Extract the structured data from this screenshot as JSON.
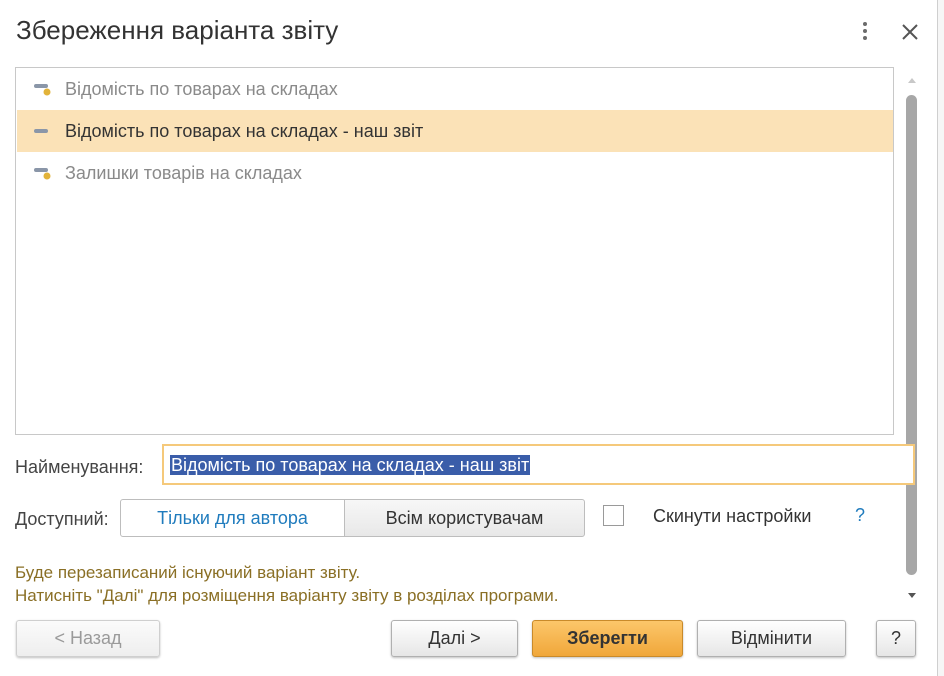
{
  "dialog": {
    "title": "Збереження варіанта звіту"
  },
  "list": {
    "items": [
      {
        "label": "Відомість по товарах на складах"
      },
      {
        "label": "Відомість по товарах на складах - наш звіт"
      },
      {
        "label": "Залишки товарів на складах"
      }
    ]
  },
  "form": {
    "name_label": "Найменування:",
    "name_value": "Відомість по товарах на складах - наш звіт",
    "available_label": "Доступний:",
    "option_author": "Тільки для автора",
    "option_all": "Всім користувачам",
    "reset_label": "Скинути настройки",
    "help": "?"
  },
  "info": {
    "line1": "Буде перезаписаний існуючий варіант звіту.",
    "line2": "Натисніть \"Далі\" для розміщення варіанту звіту в розділах програми."
  },
  "buttons": {
    "back": "<  Назад",
    "next": "Далі  >",
    "save": "Зберегти",
    "cancel": "Відмінити",
    "help": "?"
  },
  "colors": {
    "selected_row": "#fbe2b7",
    "primary_button": "#f0a73a",
    "link_blue": "#1f7bbd",
    "info_text": "#8a6f25",
    "selection_highlight": "#3a5da9"
  }
}
